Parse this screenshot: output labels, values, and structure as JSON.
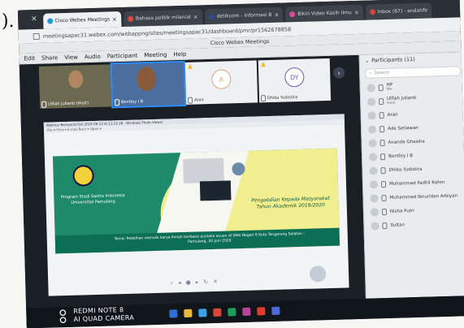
{
  "paren": ").",
  "tabs": [
    {
      "label": "Cisco Webex Meetings",
      "color": "#1e9bd7",
      "active": true
    },
    {
      "label": "Bahasa politik milenial",
      "color": "#e0483d",
      "active": false
    },
    {
      "label": "detikcom - Informasi B",
      "color": "#2f4b8f",
      "active": false
    },
    {
      "label": "Bikin Video Kasih Ilmu",
      "color": "#d94b9a",
      "active": false
    },
    {
      "label": "Inbox (67) - endahfir",
      "color": "#d44638",
      "active": false
    }
  ],
  "address": "meetingsapac31.webex.com/webappng/sites/meetingsapac31/dashboard/pmr/pr1562678858",
  "app_title": "Cisco Webex Meetings",
  "menu": [
    "Edit",
    "Share",
    "View",
    "Audio",
    "Participant",
    "Meeting",
    "Help"
  ],
  "thumbs": [
    {
      "name": "Ulfiah Julianti (Host)",
      "type": "video"
    },
    {
      "name": "Bentley I B",
      "type": "video"
    },
    {
      "name": "Aran",
      "type": "avatar",
      "letter": "A"
    },
    {
      "name": "Dhika Yudistira",
      "type": "avatar",
      "letter": "DY"
    }
  ],
  "shared_window_title": "Webinar Bersyarat Fyti 2019-08-13 at 11:22:28 - Windows Photo Viewer",
  "shared_toolbar": "File ▾   Print ▾   E-mail   Burn ▾   Open ▾",
  "slide": {
    "left_text": "Program Studi Sastra Indonesia Universitas Pamulang",
    "right_title": "Pengabdian Kepada Masyarakat Tahun Akademik 2019/2020",
    "band_text": "Tema: Pelatihan menulis karya ilmiah berbasis pustaka acuan di SMA Negeri 6 Kota Tangerang Selatan - Pamulang, 20 Juni 2020"
  },
  "panel": {
    "header": "Participants (11)",
    "search_placeholder": "Search",
    "participants": [
      {
        "name": "HP",
        "role": "Me"
      },
      {
        "name": "Ulfiah Julianti",
        "role": "Host"
      },
      {
        "name": "Aran",
        "role": ""
      },
      {
        "name": "Ade Setiawan",
        "role": ""
      },
      {
        "name": "Ananda Ghaisha",
        "role": ""
      },
      {
        "name": "Bentley I B",
        "role": ""
      },
      {
        "name": "Dhika Yudistira",
        "role": ""
      },
      {
        "name": "Muhammad Fadhil Rahm",
        "role": ""
      },
      {
        "name": "Muhammad Ibnuridan Arbiyan",
        "role": ""
      },
      {
        "name": "Nisha Putri",
        "role": ""
      },
      {
        "name": "Sultan",
        "role": ""
      }
    ]
  },
  "watermark": {
    "line1": "REDMI NOTE 8",
    "line2": "AI QUAD CAMERA"
  },
  "colors": {
    "accent": "#2f8fff",
    "slide_green": "#1f8a6a",
    "slide_yellow": "#f0ee8e"
  },
  "taskbar_icon_colors": [
    "#2d6fd6",
    "#e9b73a",
    "#3aa0e9",
    "#d9463b",
    "#1d9e5a",
    "#b8439a",
    "#e03b2f",
    "#4b6ad6"
  ]
}
